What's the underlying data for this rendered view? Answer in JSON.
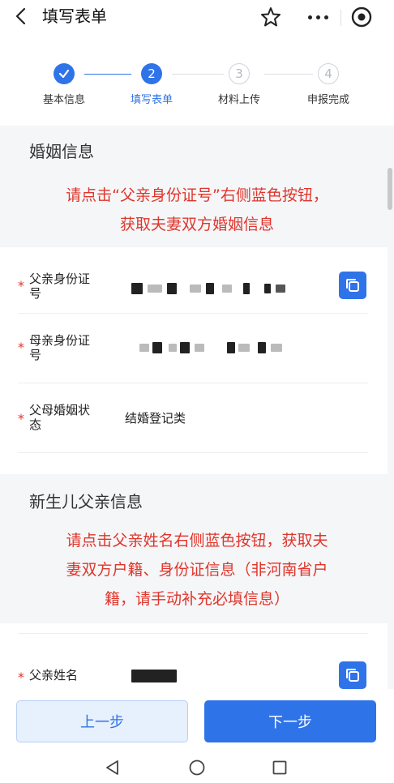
{
  "header": {
    "title": "填写表单",
    "icons": [
      "back-icon",
      "star-icon",
      "more-icon",
      "target-icon"
    ]
  },
  "steps": [
    {
      "number": "",
      "label": "基本信息",
      "state": "done"
    },
    {
      "number": "2",
      "label": "填写表单",
      "state": "active"
    },
    {
      "number": "3",
      "label": "材料上传",
      "state": "todo"
    },
    {
      "number": "4",
      "label": "申报完成",
      "state": "todo"
    }
  ],
  "marriage_section": {
    "title": "婚姻信息",
    "notice_line1": "请点击“父亲身份证号”右侧蓝色按钮，",
    "notice_line2": "获取夫妻双方婚姻信息",
    "fields": [
      {
        "label_line1": "父亲身份证",
        "label_line2": "号",
        "required": "*",
        "value": ""
      },
      {
        "label_line1": "母亲身份证",
        "label_line2": "号",
        "required": "*",
        "value": ""
      },
      {
        "label_line1": "父母婚姻状",
        "label_line2": "态",
        "required": "*",
        "value": "结婚登记类"
      }
    ]
  },
  "father_section": {
    "title": "新生儿父亲信息",
    "notice_line1": "请点击父亲姓名右侧蓝色按钮，获取夫",
    "notice_line2": "妻双方户籍、身份证信息（非河南省户",
    "notice_line3": "籍，请手动补充必填信息）",
    "fields": [
      {
        "label": "父亲姓名",
        "required": "*",
        "value": ""
      }
    ]
  },
  "buttons": {
    "prev": "上一步",
    "next": "下一步"
  },
  "colors": {
    "accent": "#2f73e8",
    "notice_red": "#e0352b",
    "background": "#f5f6f8"
  }
}
